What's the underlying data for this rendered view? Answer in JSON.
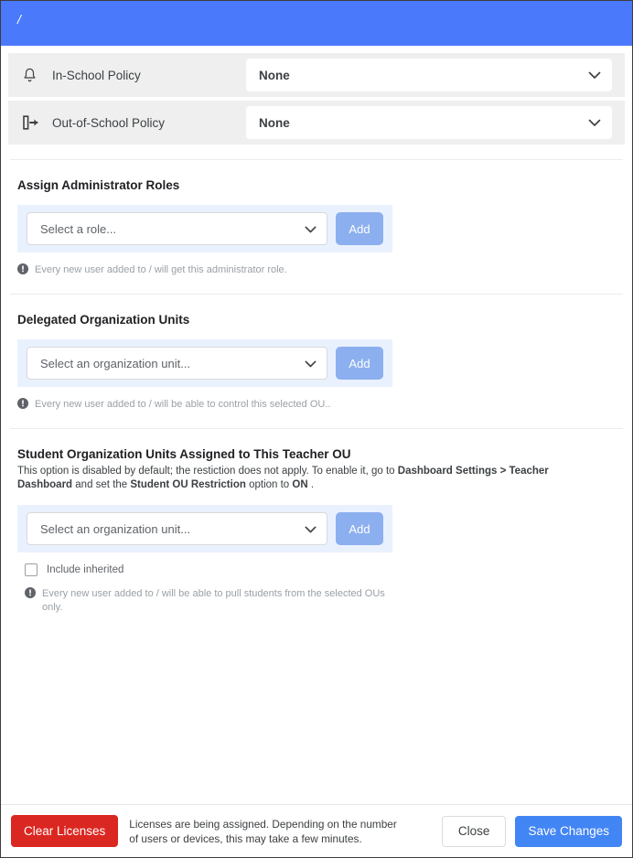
{
  "header": {
    "title": "/"
  },
  "policies": [
    {
      "icon": "bell-icon",
      "label": "In-School Policy",
      "value": "None"
    },
    {
      "icon": "exit-arrow-icon",
      "label": "Out-of-School Policy",
      "value": "None"
    }
  ],
  "sections": {
    "admin_roles": {
      "title": "Assign Administrator Roles",
      "select_placeholder": "Select a role...",
      "add_label": "Add",
      "note": "Every new user added to / will get this administrator role."
    },
    "delegated_ou": {
      "title": "Delegated Organization Units",
      "select_placeholder": "Select an organization unit...",
      "add_label": "Add",
      "note": "Every new user added to / will be able to control this selected OU.."
    },
    "student_ou": {
      "title": "Student Organization Units Assigned to This Teacher OU",
      "desc_part1": "This option is disabled by default; the restiction does not apply. To enable it, go to ",
      "desc_bold1": "Dashboard Settings > Teacher Dashboard",
      "desc_part2": " and set the ",
      "desc_bold2": "Student OU Restriction",
      "desc_part3": " option to ",
      "desc_bold3": "ON",
      "desc_part4": " .",
      "select_placeholder": "Select an organization unit...",
      "add_label": "Add",
      "checkbox_label": "Include inherited",
      "note": "Every new user added to / will be able to pull students from the selected OUs only."
    }
  },
  "footer": {
    "clear_label": "Clear Licenses",
    "message": "Licenses are being assigned. Depending on the number of users or devices, this may take a few minutes.",
    "close_label": "Close",
    "save_label": "Save Changes"
  },
  "colors": {
    "header_blue": "#4a7afb",
    "accent_blue": "#4285f4",
    "add_button_blue": "#8cafef",
    "strip_blue": "#eaf1fe",
    "danger_red": "#db2721",
    "row_gray": "#efefef"
  }
}
